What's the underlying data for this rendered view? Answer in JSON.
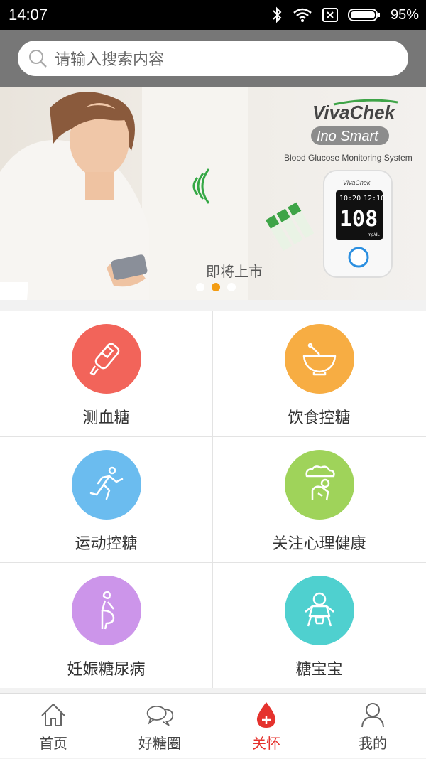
{
  "status": {
    "time": "14:07",
    "battery": "95%"
  },
  "search": {
    "placeholder": "请输入搜索内容"
  },
  "banner": {
    "brand": "VivaChek",
    "product": "Ino Smart",
    "tagline": "Blood Glucose Monitoring System",
    "meter_time_left": "10:20",
    "meter_time_right": "12:10",
    "meter_value": "108",
    "meter_unit": "mg/dL",
    "caption": "即将上市",
    "active_dot": 1
  },
  "features": [
    {
      "label": "测血糖",
      "icon": "glucose-meter-icon",
      "color": "#f2645a"
    },
    {
      "label": "饮食控糖",
      "icon": "bowl-icon",
      "color": "#f7ad43"
    },
    {
      "label": "运动控糖",
      "icon": "running-person-icon",
      "color": "#6bbcef"
    },
    {
      "label": "关注心理健康",
      "icon": "thinking-person-icon",
      "color": "#9fd35a"
    },
    {
      "label": "妊娠糖尿病",
      "icon": "pregnant-woman-icon",
      "color": "#cc95ea"
    },
    {
      "label": "糖宝宝",
      "icon": "baby-icon",
      "color": "#4fd0cf"
    }
  ],
  "tabs": [
    {
      "label": "首页",
      "icon": "home-icon"
    },
    {
      "label": "好糖圈",
      "icon": "chat-bubbles-icon"
    },
    {
      "label": "关怀",
      "icon": "blood-drop-plus-icon",
      "active": true
    },
    {
      "label": "我的",
      "icon": "person-icon"
    }
  ],
  "colors": {
    "accent": "#e5322d",
    "dot_active": "#f39c12"
  }
}
